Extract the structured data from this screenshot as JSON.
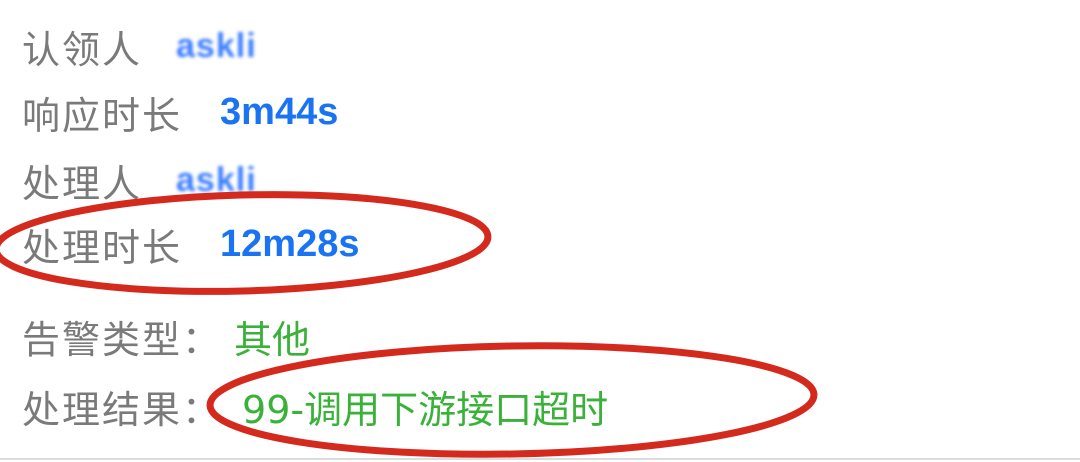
{
  "fields": {
    "claimant": {
      "label": "认领人",
      "value": "askli"
    },
    "response_time": {
      "label": "响应时长",
      "value": "3m44s"
    },
    "handler": {
      "label": "处理人",
      "value": "askli"
    },
    "handle_time": {
      "label": "处理时长",
      "value": "12m28s"
    },
    "alert_type": {
      "label": "告警类型：",
      "value": "其他"
    },
    "result": {
      "label": "处理结果：",
      "value": "99-调用下游接口超时"
    }
  },
  "colors": {
    "label": "#7a7a7a",
    "blue_value": "#1a73f0",
    "green_value": "#3ab23a",
    "annotation": "#d42a1e"
  }
}
